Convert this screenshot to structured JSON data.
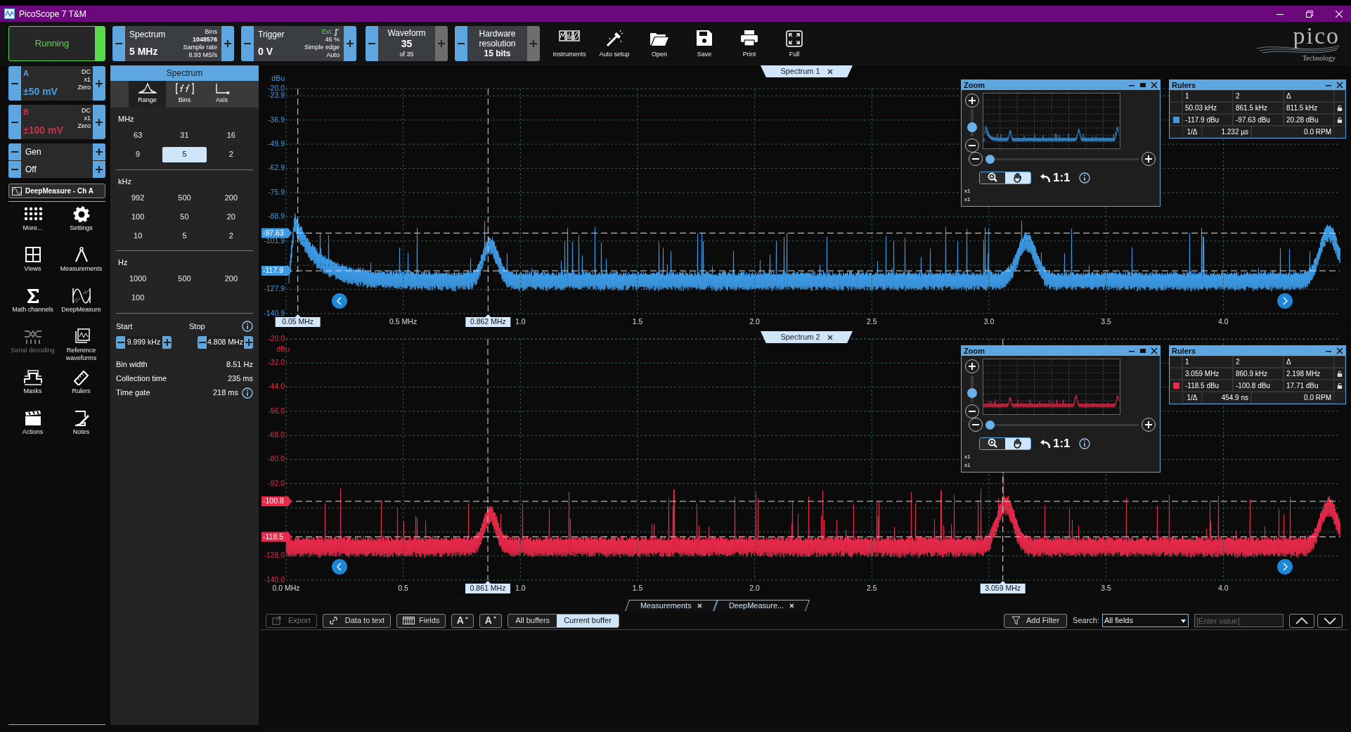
{
  "window": {
    "title": "PicoScope 7 T&M"
  },
  "toolbar": {
    "run": {
      "label": "Running"
    },
    "mode": {
      "label": "Spectrum",
      "value": "5 MHz",
      "bins_label": "Bins",
      "bins": "1048576",
      "rate_label": "Sample rate",
      "rate": "8.93 MS/s"
    },
    "trigger": {
      "label": "Trigger",
      "value": "0 V",
      "source": "Ext",
      "percent": "46 %",
      "type": "Simple edge",
      "mode": "Auto"
    },
    "waveform": {
      "label": "Waveform",
      "value": "35",
      "of": "of 35",
      "next_disabled": true
    },
    "resolution": {
      "label": "Hardware resolution",
      "value": "15 bits",
      "next_disabled": true
    },
    "buttons": [
      {
        "label": "Instruments",
        "kind": "instruments"
      },
      {
        "label": "Auto setup",
        "kind": "autosetup"
      },
      {
        "label": "Open",
        "kind": "open"
      },
      {
        "label": "Save",
        "kind": "save"
      },
      {
        "label": "Print",
        "kind": "print"
      },
      {
        "label": "Full",
        "kind": "full"
      }
    ],
    "logo": {
      "name": "pico",
      "tagline": "Technology"
    }
  },
  "channels": [
    {
      "name": "A",
      "range": "±50 mV",
      "coupling": "DC",
      "probe": "x1",
      "offset": "Zero",
      "color": "#4a9fe6"
    },
    {
      "name": "B",
      "range": "±100 mV",
      "coupling": "DC",
      "probe": "x1",
      "offset": "Zero",
      "color": "#c8334a"
    }
  ],
  "generator": {
    "label": "Gen",
    "value": "Off"
  },
  "deepmeasure": {
    "label": "DeepMeasure - Ch A"
  },
  "tools": [
    {
      "label": "More...",
      "kind": "more",
      "disabled": false
    },
    {
      "label": "Settings",
      "kind": "settings",
      "disabled": false
    },
    {
      "label": "Views",
      "kind": "views",
      "disabled": false
    },
    {
      "label": "Measurements",
      "kind": "measurements",
      "disabled": false
    },
    {
      "label": "Math channels",
      "kind": "math",
      "disabled": false
    },
    {
      "label": "DeepMeasure",
      "kind": "deepmeasure",
      "disabled": false
    },
    {
      "label": "Serial decoding",
      "kind": "serial",
      "disabled": true
    },
    {
      "label": "Reference waveforms",
      "kind": "reference",
      "disabled": false
    },
    {
      "label": "Masks",
      "kind": "masks",
      "disabled": false
    },
    {
      "label": "Rulers",
      "kind": "rulers",
      "disabled": false
    },
    {
      "label": "Actions",
      "kind": "actions",
      "disabled": false
    },
    {
      "label": "Notes",
      "kind": "notes",
      "disabled": false
    }
  ],
  "settings_panel": {
    "title": "Spectrum",
    "tabs": [
      {
        "label": "Range",
        "kind": "range",
        "selected": true
      },
      {
        "label": "Bins",
        "kind": "bins",
        "selected": false
      },
      {
        "label": "Axis",
        "kind": "axis",
        "selected": false
      }
    ],
    "groups": [
      {
        "unit": "MHz",
        "options": [
          {
            "label": "63",
            "selected": false
          },
          {
            "label": "31",
            "selected": false
          },
          {
            "label": "16",
            "selected": false
          },
          {
            "label": "9",
            "selected": false
          },
          {
            "label": "5",
            "selected": true
          },
          {
            "label": "2",
            "selected": false
          }
        ]
      },
      {
        "unit": "kHz",
        "options": [
          {
            "label": "992",
            "selected": false
          },
          {
            "label": "500",
            "selected": false
          },
          {
            "label": "200",
            "selected": false
          },
          {
            "label": "100",
            "selected": false
          },
          {
            "label": "50",
            "selected": false
          },
          {
            "label": "20",
            "selected": false
          },
          {
            "label": "10",
            "selected": false
          },
          {
            "label": "5",
            "selected": false
          },
          {
            "label": "2",
            "selected": false
          }
        ]
      },
      {
        "unit": "Hz",
        "options": [
          {
            "label": "1000",
            "selected": false
          },
          {
            "label": "500",
            "selected": false
          },
          {
            "label": "200",
            "selected": false
          },
          {
            "label": "100",
            "selected": false
          }
        ]
      }
    ],
    "start": {
      "label": "Start",
      "value": "9.999 kHz"
    },
    "stop": {
      "label": "Stop",
      "value": "4.808 MHz"
    },
    "stats": [
      {
        "label": "Bin width",
        "value": "8.51 Hz",
        "info": false
      },
      {
        "label": "Collection time",
        "value": "235 ms",
        "info": false
      },
      {
        "label": "Time gate",
        "value": "218 ms",
        "info": true
      }
    ]
  },
  "views": [
    {
      "tab": "Spectrum 1",
      "color": "#3d9be6",
      "chart_data": {
        "type": "line",
        "ylabel": "dBu",
        "xlim": [
          0,
          4.5
        ],
        "ylim": [
          -140.9,
          -20
        ],
        "xticks": [
          {
            "value": 0.5,
            "label": "0.5 MHz"
          },
          {
            "value": 1,
            "label": "1.0"
          },
          {
            "value": 1.5,
            "label": "1.5"
          },
          {
            "value": 2,
            "label": "2.0"
          },
          {
            "value": 2.5,
            "label": "2.5"
          },
          {
            "value": 3,
            "label": "3.0"
          },
          {
            "value": 3.5,
            "label": "3.5"
          },
          {
            "value": 4,
            "label": "4.0"
          }
        ],
        "yticks": [
          {
            "value": -20,
            "label": "-20.0"
          },
          {
            "value": -23.9,
            "label": "-23.9"
          },
          {
            "value": -36.9,
            "label": "-36.9"
          },
          {
            "value": -49.9,
            "label": "-49.9"
          },
          {
            "value": -62.9,
            "label": "-62.9"
          },
          {
            "value": -75.9,
            "label": "-75.9"
          },
          {
            "value": -88.9,
            "label": "-88.9"
          },
          {
            "value": -101.9,
            "label": "-101.9"
          },
          {
            "value": -127.9,
            "label": "-127.9"
          },
          {
            "value": -140.9,
            "label": "-140.9"
          }
        ],
        "grid": true,
        "ref_lines": [
          {
            "axis": "y",
            "value": -97.63,
            "label": "-97.63"
          },
          {
            "axis": "y",
            "value": -117.9,
            "label": "-117.9"
          },
          {
            "axis": "x",
            "value": 0.05,
            "label": "0.05 MHz"
          },
          {
            "axis": "x",
            "value": 0.862,
            "label": "0.862 MHz"
          }
        ]
      },
      "zoom": {
        "title": "Zoom",
        "vertical": {
          "level": 0.25
        },
        "horizontal": {
          "level": 0
        },
        "x_factor": "x1",
        "y_factor": "x1",
        "modes": [
          {
            "kind": "zoom",
            "selected": false
          },
          {
            "kind": "pan",
            "selected": true
          }
        ],
        "reset": "1:1"
      },
      "rulers": {
        "title": "Rulers",
        "headers": [
          "1",
          "2",
          "Δ"
        ],
        "rows": [
          {
            "kind": "x",
            "cells": [
              "50.03 kHz",
              "861.5 kHz",
              "811.5 kHz"
            ]
          },
          {
            "kind": "y",
            "cells": [
              "-117.9 dBu",
              "-97.63 dBu",
              "20.28 dBu"
            ]
          }
        ],
        "inverse_label": "1/Δ",
        "inverse": "1.232 µs",
        "rpm": "0.0 RPM"
      }
    },
    {
      "tab": "Spectrum 2",
      "color": "#e8294a",
      "chart_data": {
        "type": "line",
        "ylabel": "dBu",
        "xlim": [
          0,
          4.5
        ],
        "ylim": [
          -140,
          -20
        ],
        "xticks": [
          {
            "value": 0,
            "label": "0.0 MHz"
          },
          {
            "value": 0.5,
            "label": "0.5"
          },
          {
            "value": 1,
            "label": "1.0"
          },
          {
            "value": 1.5,
            "label": "1.5"
          },
          {
            "value": 2,
            "label": "2.0"
          },
          {
            "value": 2.5,
            "label": "2.5"
          },
          {
            "value": 3.5,
            "label": "3.5"
          },
          {
            "value": 4,
            "label": "4.0"
          }
        ],
        "yticks": [
          {
            "value": -20,
            "label": "-20.0"
          },
          {
            "value": -32,
            "label": "-32.0"
          },
          {
            "value": -44,
            "label": "-44.0"
          },
          {
            "value": -56,
            "label": "-56.0"
          },
          {
            "value": -68,
            "label": "-68.0"
          },
          {
            "value": -80,
            "label": "-80.0"
          },
          {
            "value": -92,
            "label": "-92.0"
          },
          {
            "value": -128,
            "label": "-128.0"
          },
          {
            "value": -140,
            "label": "-140.0"
          }
        ],
        "grid": true,
        "ref_lines": [
          {
            "axis": "y",
            "value": -100.8,
            "label": "-100.8"
          },
          {
            "axis": "y",
            "value": -118.5,
            "label": "-118.5"
          },
          {
            "axis": "x",
            "value": 0.861,
            "label": "0.861 MHz"
          },
          {
            "axis": "x",
            "value": 3.059,
            "label": "3.059 MHz"
          }
        ]
      },
      "zoom": {
        "title": "Zoom",
        "vertical": {
          "level": 0.25
        },
        "horizontal": {
          "level": 0
        },
        "x_factor": "x1",
        "y_factor": "x1",
        "modes": [
          {
            "kind": "zoom",
            "selected": false
          },
          {
            "kind": "pan",
            "selected": true
          }
        ],
        "reset": "1:1"
      },
      "rulers": {
        "title": "Rulers",
        "headers": [
          "1",
          "2",
          "Δ"
        ],
        "rows": [
          {
            "kind": "x",
            "cells": [
              "3.059 MHz",
              "860.9 kHz",
              "2.198 MHz"
            ]
          },
          {
            "kind": "y",
            "cells": [
              "-118.5 dBu",
              "-100.8 dBu",
              "17.71 dBu"
            ]
          }
        ],
        "inverse_label": "1/Δ",
        "inverse": "454.9 ns",
        "rpm": "0.0 RPM"
      }
    }
  ],
  "results": {
    "tabs": [
      {
        "label": "Measurements"
      },
      {
        "label": "DeepMeasure..."
      }
    ],
    "actions": [
      {
        "label": "Export",
        "kind": "export",
        "disabled": true
      },
      {
        "label": "Data to text",
        "kind": "link",
        "disabled": false
      },
      {
        "label": "Fields",
        "kind": "fields",
        "disabled": false
      }
    ],
    "font_buttons": [
      {
        "label": "A",
        "kind": "up"
      },
      {
        "label": "A",
        "kind": "down"
      }
    ],
    "buffers": [
      {
        "label": "All buffers",
        "selected": false
      },
      {
        "label": "Current buffer",
        "selected": true
      }
    ],
    "add_filter": "Add Filter",
    "search_label": "Search:",
    "search_field": "All fields",
    "value_placeholder": "[Enter value]"
  }
}
